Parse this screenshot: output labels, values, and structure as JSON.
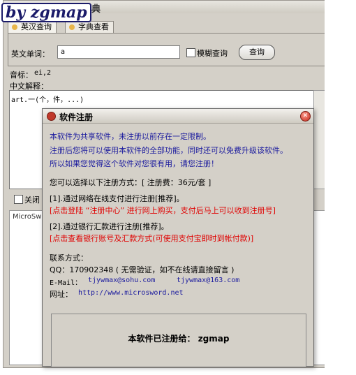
{
  "app": {
    "title": "超级英汉词典",
    "watermark": "by zgmap"
  },
  "tabs": [
    {
      "label": "英汉查询"
    },
    {
      "label": "字典查看"
    }
  ],
  "search": {
    "word_label": "英文单词：",
    "input_value": "a",
    "fuzzy_label": "模糊查询",
    "query_button": "查询"
  },
  "result": {
    "phonetic_label": "音标：",
    "phonetic_value": "ei,2",
    "meaning_label": "中文解释：",
    "meaning_text": "art.一(个，件，...)"
  },
  "bottom": {
    "close_label": "关闭",
    "panel_label": "MicroSw"
  },
  "dialog": {
    "title": "软件注册",
    "intro": [
      "本软件为共享软件，未注册以前存在一定限制。",
      "注册后您将可以使用本软件的全部功能，同时还可以免费升级该软件。",
      "所以如果您觉得这个软件对您很有用，请您注册！"
    ],
    "methods_intro": "您可以选择以下注册方式：[ 注册费：36元/套 ]",
    "method1": "[1].通过网络在线支付进行注册[推荐]。",
    "method1_link": "[点击登陆 “注册中心” 进行网上购买，支付后马上可以收到注册号]",
    "method2": "[2].通过银行汇款进行注册[推荐]。",
    "method2_link": "[点击查看银行账号及汇款方式(可使用支付宝即时到帐付款)]",
    "contact_label": "联系方式：",
    "qq": "QQ：170902348 ( 无需验证，如不在线请直接留言 )",
    "email_label": "E-Mail：",
    "email1": "tjywmax@sohu.com",
    "email2": "tjywmax@163.com",
    "website_label": "网址：",
    "website": "http://www.microsword.net",
    "registered_to": "本软件已注册给： zgmap"
  },
  "colors": {
    "accent_blue": "#1a1a9e",
    "link_red": "#e00000",
    "window_gray": "#d4d0c8"
  }
}
